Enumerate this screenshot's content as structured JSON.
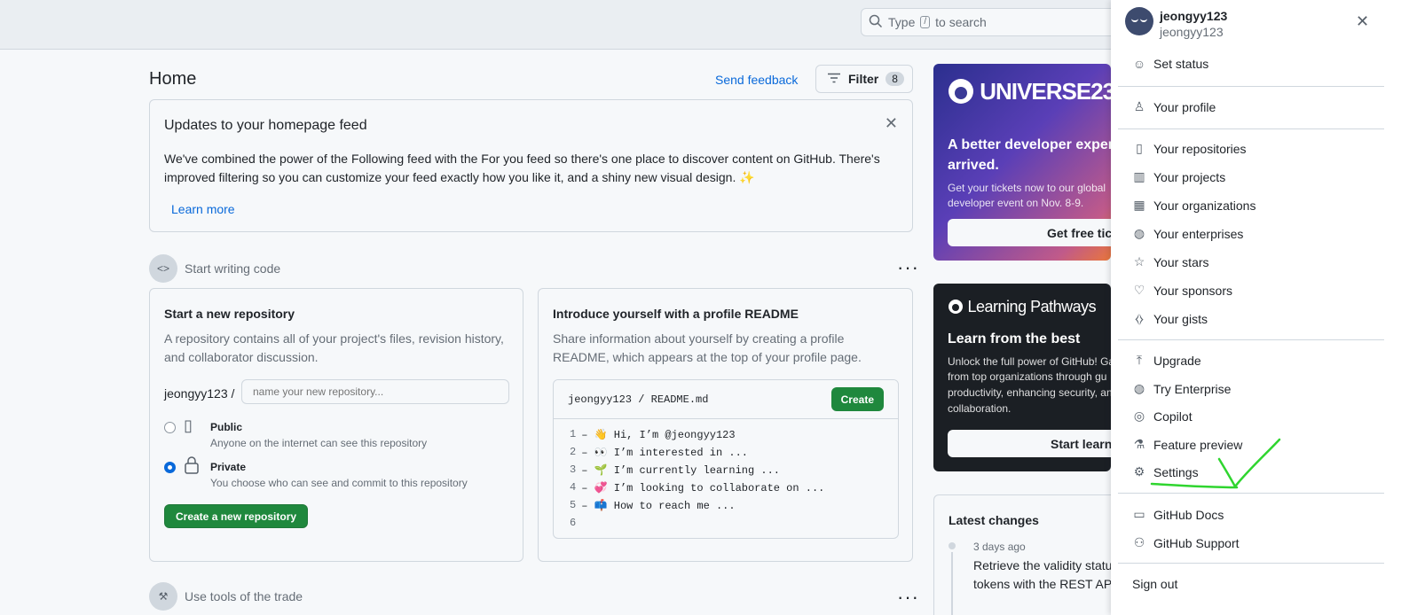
{
  "search": {
    "text_before": "Type",
    "slash_key": "/",
    "text_after": "to search"
  },
  "home": {
    "title": "Home",
    "send_feedback": "Send feedback",
    "filter_label": "Filter",
    "filter_count": "8"
  },
  "updates": {
    "title": "Updates to your homepage feed",
    "body": "We've combined the power of the Following feed with the For you feed so there's one place to discover content on GitHub. There's improved filtering so you can customize your feed exactly how you like it, and a shiny new visual design. ✨",
    "learn_more": "Learn more"
  },
  "start_writing": {
    "label": "Start writing code"
  },
  "new_repo": {
    "title": "Start a new repository",
    "description": "A repository contains all of your project's files, revision history, and collaborator discussion.",
    "owner": "jeongyy123 /",
    "name_placeholder": "name your new repository...",
    "public_label": "Public",
    "public_desc": "Anyone on the internet can see this repository",
    "private_label": "Private",
    "private_desc": "You choose who can see and commit to this repository",
    "selected_visibility": "Private",
    "create_button": "Create a new repository"
  },
  "readme": {
    "title": "Introduce yourself with a profile README",
    "description": "Share information about yourself by creating a profile README, which appears at the top of your profile page.",
    "path": "jeongyy123 / README.md",
    "create_button": "Create",
    "lines": [
      {
        "num": "1",
        "text": "– 👋 Hi, I’m @jeongyy123"
      },
      {
        "num": "2",
        "text": "– 👀 I’m interested in ..."
      },
      {
        "num": "3",
        "text": "– 🌱 I’m currently learning ..."
      },
      {
        "num": "4",
        "text": "– 💞️ I’m looking to collaborate on ..."
      },
      {
        "num": "5",
        "text": "– 📫 How to reach me ..."
      },
      {
        "num": "6",
        "text": ""
      }
    ]
  },
  "tools": {
    "label": "Use tools of the trade"
  },
  "promo_universe": {
    "logo": "UNIVERSE23",
    "headline_1": "A better developer experi",
    "headline_2": "arrived.",
    "text_1": "Get your tickets now to our global",
    "text_2": "developer event on Nov. 8-9.",
    "button": "Get free tick"
  },
  "promo_learning": {
    "logo": "Learning Pathways",
    "headline": "Learn from the best",
    "text_1": "Unlock the full power of GitHub! Ga",
    "text_2": "from top organizations through gu",
    "text_3": "productivity, enhancing security, an",
    "text_4": "collaboration.",
    "button": "Start learni"
  },
  "latest_changes": {
    "title": "Latest changes",
    "ago": "3 days ago",
    "text_1": "Retrieve the validity status",
    "text_2": "tokens with the REST API"
  },
  "user_menu": {
    "username": "jeongyy123",
    "login": "jeongyy123",
    "items": [
      {
        "label": "Set status",
        "icon": "smiley-icon"
      },
      {
        "label": "Your profile",
        "icon": "person-icon"
      },
      {
        "label": "Your repositories",
        "icon": "repo-icon"
      },
      {
        "label": "Your projects",
        "icon": "project-icon"
      },
      {
        "label": "Your organizations",
        "icon": "organization-icon"
      },
      {
        "label": "Your enterprises",
        "icon": "globe-icon"
      },
      {
        "label": "Your stars",
        "icon": "star-icon"
      },
      {
        "label": "Your sponsors",
        "icon": "heart-icon"
      },
      {
        "label": "Your gists",
        "icon": "code-square-icon"
      },
      {
        "label": "Upgrade",
        "icon": "upload-icon"
      },
      {
        "label": "Try Enterprise",
        "icon": "globe-icon"
      },
      {
        "label": "Copilot",
        "icon": "copilot-icon"
      },
      {
        "label": "Feature preview",
        "icon": "beaker-icon"
      },
      {
        "label": "Settings",
        "icon": "gear-icon"
      },
      {
        "label": "GitHub Docs",
        "icon": "book-icon"
      },
      {
        "label": "GitHub Support",
        "icon": "people-icon"
      },
      {
        "label": "Sign out",
        "icon": ""
      }
    ]
  },
  "annotation": {
    "color": "#2fd52f",
    "marks": "Settings"
  },
  "colors": {
    "accent": "#0969da",
    "primary_button": "#1f883d"
  }
}
